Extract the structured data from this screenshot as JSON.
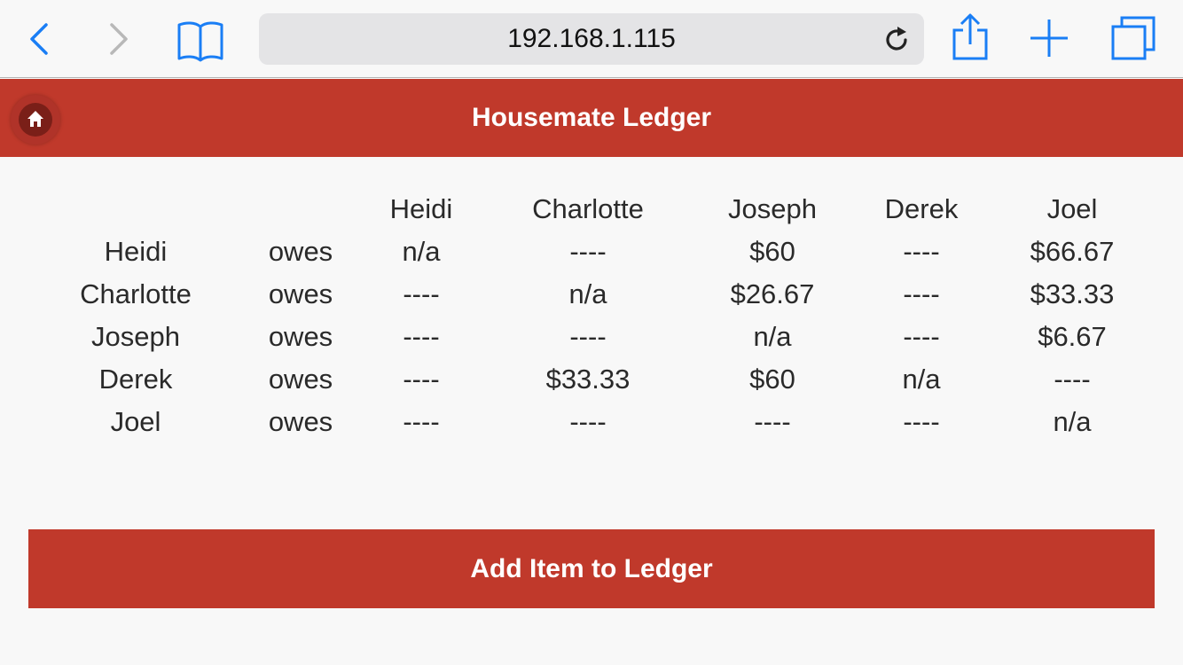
{
  "browser": {
    "url": "192.168.1.115",
    "accent_color": "#1a7ef5"
  },
  "header": {
    "title": "Housemate Ledger",
    "background_color": "#c0392b",
    "home_icon": "home-icon"
  },
  "ledger": {
    "columns": [
      "Heidi",
      "Charlotte",
      "Joseph",
      "Derek",
      "Joel"
    ],
    "owes_label": "owes",
    "rows": [
      {
        "name": "Heidi",
        "amounts": [
          "n/a",
          "----",
          "$60",
          "----",
          "$66.67"
        ]
      },
      {
        "name": "Charlotte",
        "amounts": [
          "----",
          "n/a",
          "$26.67",
          "----",
          "$33.33"
        ]
      },
      {
        "name": "Joseph",
        "amounts": [
          "----",
          "----",
          "n/a",
          "----",
          "$6.67"
        ]
      },
      {
        "name": "Derek",
        "amounts": [
          "----",
          "$33.33",
          "$60",
          "n/a",
          "----"
        ]
      },
      {
        "name": "Joel",
        "amounts": [
          "----",
          "----",
          "----",
          "----",
          "n/a"
        ]
      }
    ]
  },
  "actions": {
    "add_item_label": "Add Item to Ledger"
  }
}
